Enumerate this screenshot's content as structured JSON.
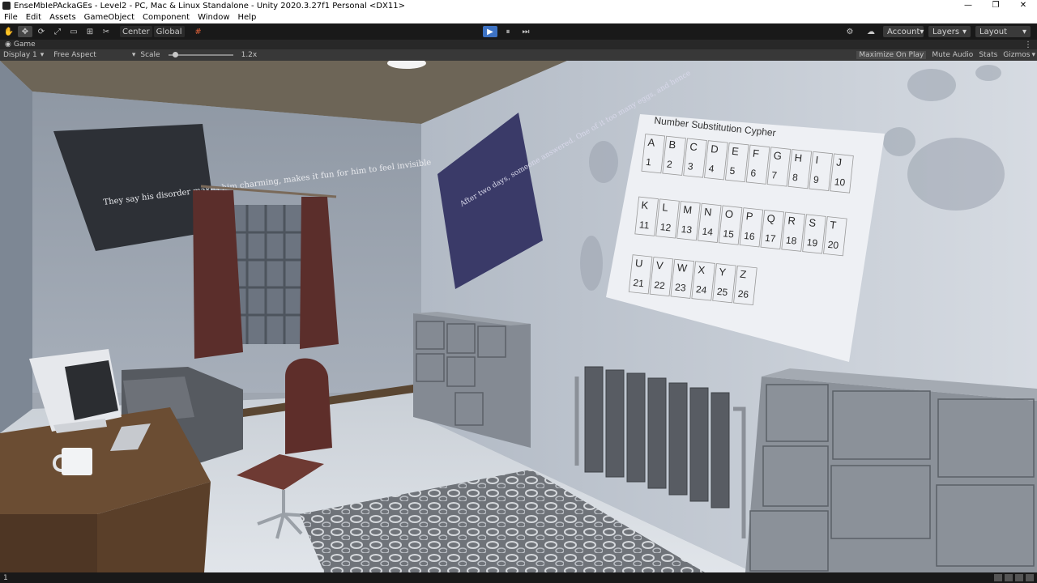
{
  "window": {
    "title": "EnseMbIePAckaGEs - Level2 - PC, Mac & Linux Standalone - Unity 2020.3.27f1 Personal <DX11>",
    "minimize": "—",
    "maximize": "❐",
    "close": "✕"
  },
  "menu": [
    "File",
    "Edit",
    "Assets",
    "GameObject",
    "Component",
    "Window",
    "Help"
  ],
  "toolbar": {
    "tools": [
      {
        "name": "hand-tool",
        "glyph": "✋"
      },
      {
        "name": "move-tool",
        "glyph": "✥"
      },
      {
        "name": "rotate-tool",
        "glyph": "⟳"
      },
      {
        "name": "scale-tool",
        "glyph": "⤢"
      },
      {
        "name": "rect-tool",
        "glyph": "▭"
      },
      {
        "name": "transform-tool",
        "glyph": "⊞"
      },
      {
        "name": "custom-tool",
        "glyph": "✂"
      }
    ],
    "pivot_label": "Center",
    "global_label": "Global",
    "snap_glyph": "#",
    "play_glyph": "▶",
    "pause_glyph": "⏸",
    "step_glyph": "⏭",
    "settings_glyph": "⚙",
    "cloud_glyph": "☁",
    "account_label": "Account",
    "layers_label": "Layers",
    "layout_label": "Layout",
    "dropdown_arrow": "▾"
  },
  "game_tab": {
    "icon": "◉",
    "label": "Game",
    "menu_glyph": "⋮"
  },
  "game_bar": {
    "display": "Display 1",
    "display_arrow": "▾",
    "aspect": "Free Aspect",
    "aspect_arrow": "▾",
    "scale_label": "Scale",
    "scale_value": "1.2x",
    "scale_level": 0.1,
    "maximize_on_play": "Maximize On Play",
    "mute_audio": "Mute Audio",
    "stats": "Stats",
    "gizmos": "Gizmos",
    "gizmos_arrow": "▾"
  },
  "scene": {
    "left_poster": "They say his disorder makes him charming, makes it fun for him to feel invisible",
    "center_poster": "After two days, someone answered. One of it too many eggs, and hence",
    "cypher": {
      "title": "Number Substitution Cypher",
      "rows": [
        {
          "letters": [
            "A",
            "B",
            "C",
            "D",
            "E",
            "F",
            "G",
            "H",
            "I",
            "J"
          ],
          "numbers": [
            "1",
            "2",
            "3",
            "4",
            "5",
            "6",
            "7",
            "8",
            "9",
            "10"
          ]
        },
        {
          "letters": [
            "K",
            "L",
            "M",
            "N",
            "O",
            "P",
            "Q",
            "R",
            "S",
            "T"
          ],
          "numbers": [
            "11",
            "12",
            "13",
            "14",
            "15",
            "16",
            "17",
            "18",
            "19",
            "20"
          ]
        },
        {
          "letters": [
            "U",
            "V",
            "W",
            "X",
            "Y",
            "Z"
          ],
          "numbers": [
            "21",
            "22",
            "23",
            "24",
            "25",
            "26"
          ]
        }
      ]
    }
  },
  "status": {
    "text": "1"
  }
}
